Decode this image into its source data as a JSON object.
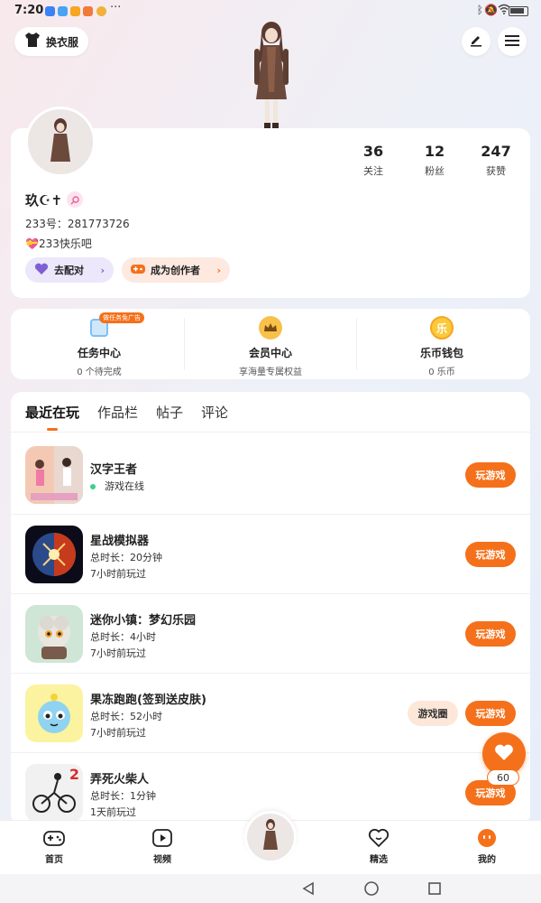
{
  "status_bar": {
    "time": "7:20",
    "dots": "···"
  },
  "header": {
    "outfit_label": "换衣服",
    "edit_icon": "pencil-icon",
    "menu_icon": "hamburger-menu-icon"
  },
  "profile": {
    "stats": [
      {
        "value": "36",
        "label": "关注"
      },
      {
        "value": "12",
        "label": "粉丝"
      },
      {
        "value": "247",
        "label": "获赞"
      }
    ],
    "nickname": "玖☪︎✝︎",
    "user_id": "233号：281773726",
    "signature": "💝233快乐吧",
    "match_label": "去配对",
    "creator_label": "成为创作者"
  },
  "services": [
    {
      "title": "任务中心",
      "sub": "0 个待完成",
      "badge": "做任务免广告",
      "icon": "task-calendar-icon"
    },
    {
      "title": "会员中心",
      "sub": "享海量专属权益",
      "icon": "crown-icon"
    },
    {
      "title": "乐币钱包",
      "sub": "0 乐币",
      "icon_text": "乐",
      "icon": "lebi-coin-icon"
    }
  ],
  "tabs": [
    "最近在玩",
    "作品栏",
    "帖子",
    "评论"
  ],
  "games": [
    {
      "name": "汉字王者",
      "status": "游戏在线",
      "button": "玩游戏"
    },
    {
      "name": "星战模拟器",
      "duration": "总时长：20分钟",
      "last": "7小时前玩过",
      "button": "玩游戏"
    },
    {
      "name": "迷你小镇：梦幻乐园",
      "duration": "总时长：4小时",
      "last": "7小时前玩过",
      "button": "玩游戏"
    },
    {
      "name": "果冻跑跑(签到送皮肤)",
      "duration": "总时长：52小时",
      "last": "7小时前玩过",
      "button": "玩游戏",
      "circle_button": "游戏圈"
    },
    {
      "name": "弄死火柴人",
      "duration": "总时长：1分钟",
      "last": "1天前玩过",
      "button": "玩游戏",
      "corner_number": "2"
    }
  ],
  "floating": {
    "count": "60"
  },
  "nav": [
    {
      "label": "首页",
      "icon": "gamepad-icon"
    },
    {
      "label": "视频",
      "icon": "video-play-icon"
    },
    {
      "label": "精选",
      "icon": "heart-chat-icon"
    },
    {
      "label": "我的",
      "icon": "profile-face-icon"
    }
  ],
  "colors": {
    "accent": "#f5701a",
    "match_chip": "#ece7fb",
    "creator_chip": "#fde9e0"
  }
}
